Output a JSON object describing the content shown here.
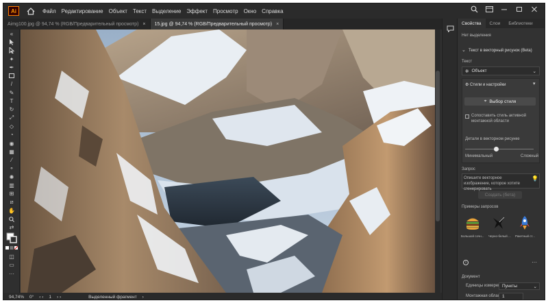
{
  "menubar": {
    "app_logo": "Ai",
    "items": [
      "Файл",
      "Редактирование",
      "Объект",
      "Текст",
      "Выделение",
      "Эффект",
      "Просмотр",
      "Окно",
      "Справка"
    ]
  },
  "tabs": [
    {
      "label": "Aimg100.jpg @ 94,74 % (RGB/Предварительный просмотр)",
      "close": "×"
    },
    {
      "label": "15.jpg @ 94,74 % (RGB/Предварительный просмотр)",
      "close": "×"
    }
  ],
  "status": {
    "zoom": "94,74%",
    "angle": "0°",
    "artboard": "1",
    "mode": "Выделенный фрагмент"
  },
  "panel": {
    "tabs": [
      "Свойства",
      "Слои",
      "Библиотеки"
    ],
    "no_selection": "Нет выделения",
    "section_title": "Текст в векторный рисунок (Beta)",
    "text_label": "Текст",
    "object_select": "Объект",
    "styles_title": "Стили и настройки",
    "choose_style_btn": "Выбор стиля",
    "match_style_label": "Сопоставить стиль активной монтажной области",
    "detail_label": "Детали в векторном рисунке",
    "detail_min": "Минимальный",
    "detail_max": "Сложный",
    "detail_value": 0.45,
    "prompt_label": "Запрос",
    "prompt_placeholder": "Опишите векторное изображение, которое хотите сгенерировать",
    "generate_btn": "Создать (бета)",
    "examples_label": "Примеры запросов",
    "examples": [
      "Большой сочн...",
      "Черно-белый ...",
      "Ракетный ст..."
    ],
    "document_label": "Документ",
    "units_label": "Единицы измерения:",
    "units_value": "Пункты",
    "artboard_label": "Монтажная область:",
    "artboard_value": "1"
  }
}
